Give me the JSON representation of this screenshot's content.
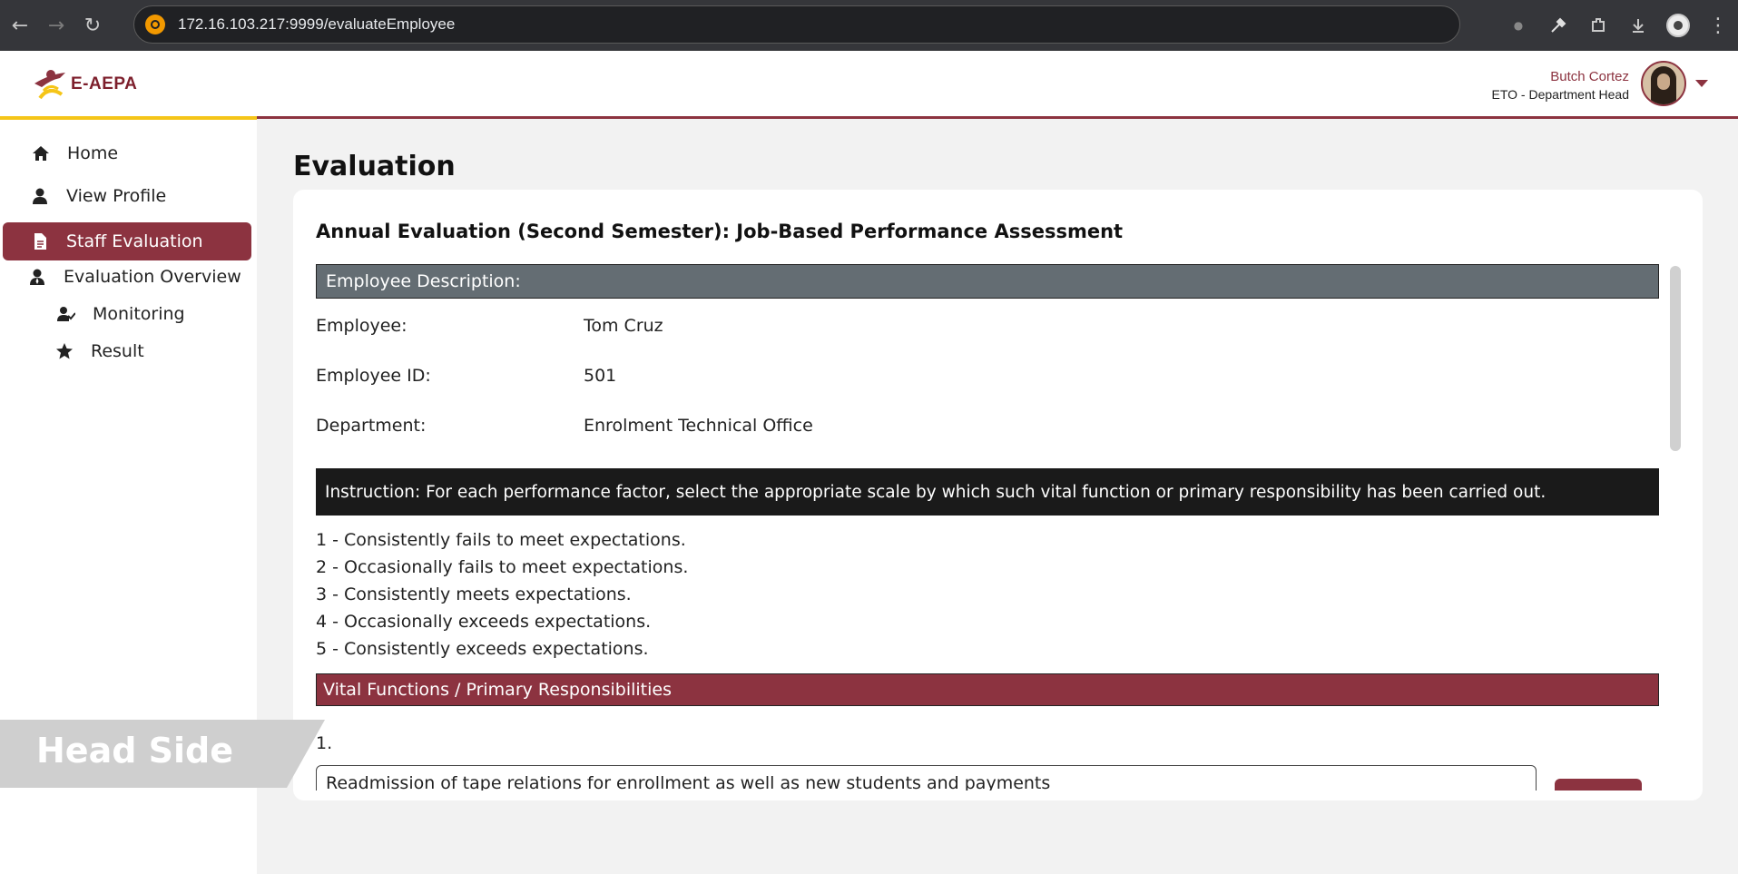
{
  "browser": {
    "url": "172.16.103.217:9999/evaluateEmployee"
  },
  "header": {
    "logo_text": "E-AEPA",
    "user_name": "Butch Cortez",
    "user_role": "ETO - Department Head"
  },
  "sidebar": {
    "items": [
      {
        "label": "Home",
        "icon": "home-icon"
      },
      {
        "label": "View Profile",
        "icon": "user-icon"
      },
      {
        "label": "Staff Evaluation",
        "icon": "document-icon",
        "active": true
      },
      {
        "label": "Evaluation Overview",
        "icon": "user-tie-icon"
      },
      {
        "label": "Monitoring",
        "icon": "user-check-icon"
      },
      {
        "label": "Result",
        "icon": "star-icon"
      }
    ]
  },
  "main": {
    "page_title": "Evaluation",
    "card_title": "Annual Evaluation (Second Semester): Job-Based Performance Assessment",
    "employee_section_title": "Employee Description:",
    "fields": [
      {
        "label": "Employee:",
        "value": "Tom Cruz"
      },
      {
        "label": "Employee ID:",
        "value": "501"
      },
      {
        "label": "Department:",
        "value": "Enrolment Technical Office"
      }
    ],
    "instruction": "Instruction: For each performance factor, select the appropriate scale by which such vital function or primary responsibility has been carried out.",
    "scale": [
      "1 - Consistently fails to meet expectations.",
      "2 - Occasionally fails to meet expectations.",
      "3 - Consistently meets expectations.",
      "4 - Occasionally exceeds expectations.",
      "5 - Consistently exceeds expectations."
    ],
    "section_title": "Vital Functions / Primary Responsibilities",
    "item_number": "1.",
    "item_text": "Readmission of tape relations for enrollment as well as new students and payments"
  },
  "watermark": {
    "text": "Head Side"
  },
  "colors": {
    "brand_red": "#8c3340",
    "brand_yellow": "#f5c518",
    "section_gray": "#646d73",
    "instruction_black": "#1a1a1a"
  }
}
